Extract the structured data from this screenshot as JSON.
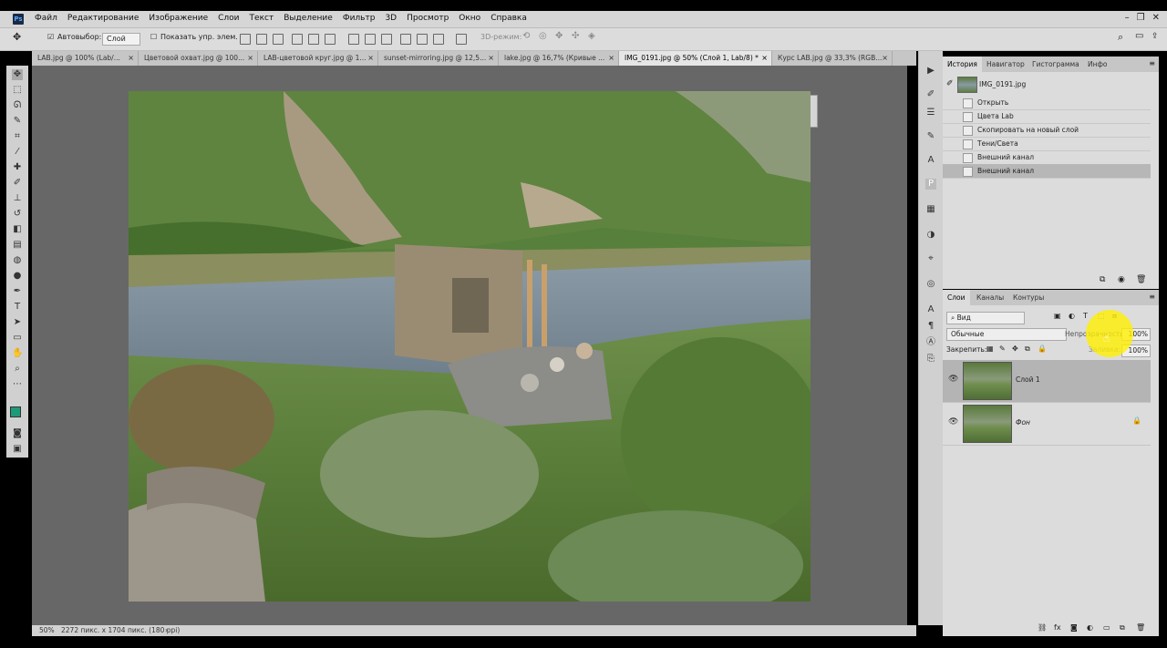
{
  "app": {
    "logo": "Ps"
  },
  "menu": [
    "Файл",
    "Редактирование",
    "Изображение",
    "Слои",
    "Текст",
    "Выделение",
    "Фильтр",
    "3D",
    "Просмотр",
    "Окно",
    "Справка"
  ],
  "window_controls": [
    "–",
    "❐",
    "✕"
  ],
  "options": {
    "autoselect_label": "Автовыбор:",
    "autoselect_value": "Слой",
    "show_transform_label": "Показать упр. элем.",
    "mode3d_label": "3D-режим:"
  },
  "tabs": [
    {
      "label": "LAB.jpg @ 100% (Lab/...",
      "active": false
    },
    {
      "label": "Цветовой охват.jpg @ 100...",
      "active": false
    },
    {
      "label": "LAB-цветовой круг.jpg @ 1...",
      "active": false
    },
    {
      "label": "sunset-mirroring.jpg @ 12,5...",
      "active": false
    },
    {
      "label": "lake.jpg @ 16,7% (Кривые ...",
      "active": false
    },
    {
      "label": "IMG_0191.jpg @ 50% (Слой 1, Lab/8) *",
      "active": true
    },
    {
      "label": "Курс LAB.jpg @ 33,3% (RGB...",
      "active": false
    }
  ],
  "status": {
    "zoom": "50%",
    "info": "2272 пикс. x 1704 пикс. (180 ppi)"
  },
  "history_panel": {
    "tabs": [
      "История",
      "Навигатор",
      "Гистограмма",
      "Инфо"
    ],
    "snapshot": "IMG_0191.jpg",
    "items": [
      "Открыть",
      "Цвета Lab",
      "Скопировать на новый слой",
      "Тени/Света",
      "Внешний канал",
      "Внешний канал"
    ],
    "selected_index": 5
  },
  "layers_panel": {
    "tabs": [
      "Слои",
      "Каналы",
      "Контуры"
    ],
    "filter": "Вид",
    "blend_mode": "Обычные",
    "opacity_label": "Непрозрачность:",
    "opacity_value": "100%",
    "lock_label": "Закрепить:",
    "fill_label": "Заливка:",
    "fill_value": "100%",
    "layers": [
      {
        "name": "Слой 1",
        "selected": true
      },
      {
        "name": "Фон",
        "selected": false,
        "locked": true
      }
    ]
  },
  "colors": {
    "foreground": "#1e9a78",
    "background": "#ffffff",
    "highlight": "#fff000"
  }
}
